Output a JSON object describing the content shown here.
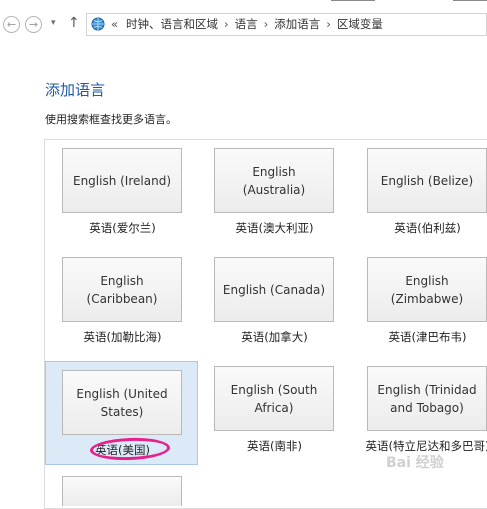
{
  "address_bar": {
    "chevrons": "«",
    "breadcrumbs": [
      "时钟、语言和区域",
      "语言",
      "添加语言",
      "区域变量"
    ]
  },
  "page": {
    "title": "添加语言",
    "subtitle": "使用搜索框查找更多语言。"
  },
  "languages": [
    {
      "tile": "English (Ireland)",
      "caption": "英语(爱尔兰)"
    },
    {
      "tile": "English (Australia)",
      "caption": "英语(澳大利亚)"
    },
    {
      "tile": "English (Belize)",
      "caption": "英语(伯利兹)"
    },
    {
      "tile": "English (Caribbean)",
      "caption": "英语(加勒比海)"
    },
    {
      "tile": "English (Canada)",
      "caption": "英语(加拿大)"
    },
    {
      "tile": "English (Zimbabwe)",
      "caption": "英语(津巴布韦)"
    },
    {
      "tile": "English (United States)",
      "caption": "英语(美国)",
      "selected": true
    },
    {
      "tile": "English (South Africa)",
      "caption": "英语(南非)"
    },
    {
      "tile": "English (Trinidad and Tobago)",
      "caption": "英语(特立尼达和多巴哥)"
    }
  ],
  "colors": {
    "title": "#1e5aa8",
    "selection": "#dceaf8",
    "highlight_circle": "#e8208c"
  },
  "icons": [
    "back-arrow-icon",
    "forward-arrow-icon",
    "dropdown-icon",
    "up-arrow-icon",
    "globe-icon"
  ],
  "watermark": "Bai 经验"
}
